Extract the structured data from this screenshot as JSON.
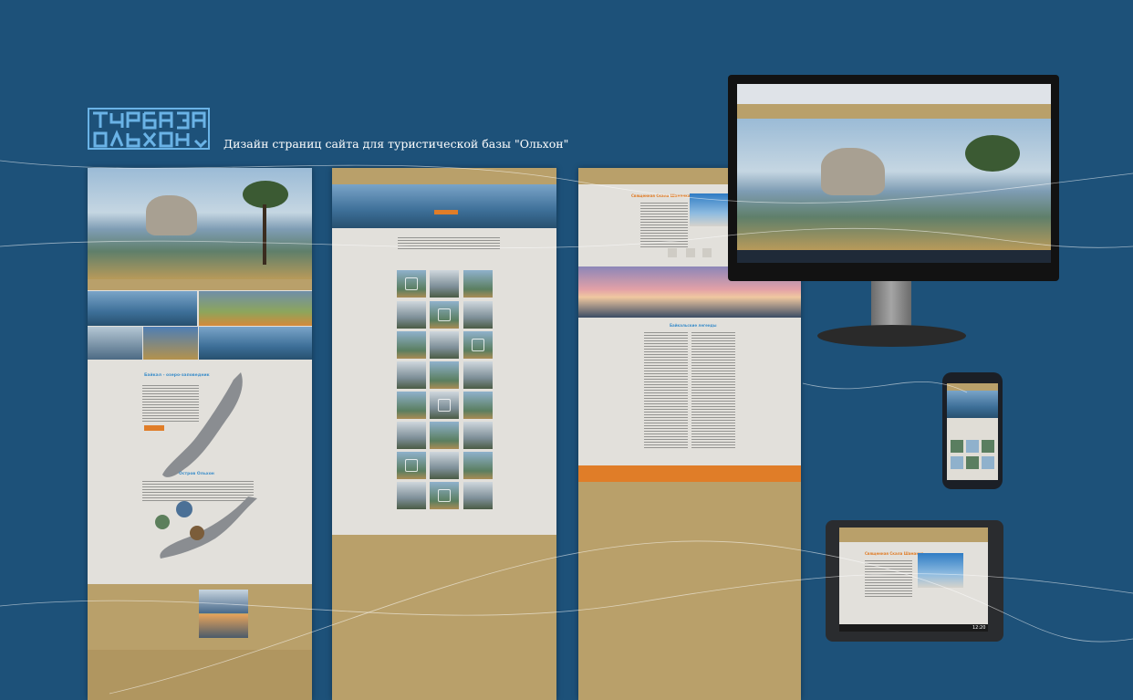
{
  "logo": {
    "line1": "ТУРБАЗА",
    "line2": "ОЛЬХОН"
  },
  "tagline": "Дизайн страниц сайта для туристической базы \"Ольхон\"",
  "colors": {
    "background": "#1d5179",
    "accent": "#e07d28",
    "tan": "#b9a06a",
    "page_grey": "#e2e0db"
  },
  "mockups": {
    "page1": {
      "headings": [
        "Байкал - озеро-заповедник",
        "Остров Ольхон"
      ]
    },
    "page2": {
      "gallery_rows": 8,
      "gallery_cols": 3
    },
    "page3": {
      "headings": [
        "Священная Скала Шаманка",
        "Байкальские легенды"
      ]
    }
  },
  "devices": [
    "monitor",
    "phone",
    "tablet"
  ],
  "tablet_time": "12:20"
}
